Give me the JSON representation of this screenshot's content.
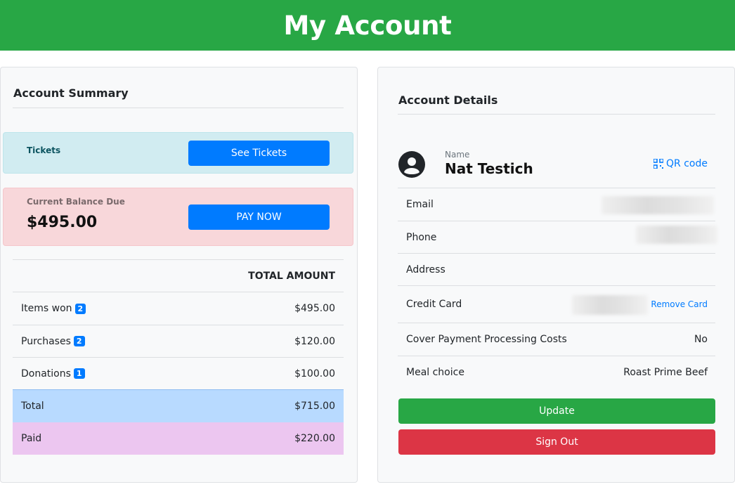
{
  "header": {
    "title": "My Account"
  },
  "summary": {
    "title": "Account Summary",
    "tickets": {
      "label": "Tickets",
      "button": "See Tickets"
    },
    "balance": {
      "label": "Current Balance Due",
      "amount": "$495.00",
      "button": "PAY NOW"
    },
    "table": {
      "header": "TOTAL AMOUNT",
      "rows": [
        {
          "label": "Items won",
          "badge": "2",
          "amount": "$495.00"
        },
        {
          "label": "Purchases",
          "badge": "2",
          "amount": "$120.00"
        },
        {
          "label": "Donations",
          "badge": "1",
          "amount": "$100.00"
        }
      ],
      "total": {
        "label": "Total",
        "amount": "$715.00"
      },
      "paid": {
        "label": "Paid",
        "amount": "$220.00"
      }
    }
  },
  "details": {
    "title": "Account Details",
    "name_label": "Name",
    "name": "Nat Testich",
    "qr_label": "QR code",
    "email_label": "Email",
    "phone_label": "Phone",
    "address_label": "Address",
    "card_label": "Credit Card",
    "remove_card": "Remove Card",
    "cover_label": "Cover Payment Processing Costs",
    "cover_value": "No",
    "meal_label": "Meal choice",
    "meal_value": "Roast Prime Beef",
    "update_button": "Update",
    "signout_button": "Sign Out"
  },
  "icons": {
    "avatar": "user-circle-icon",
    "qr": "qr-code-icon"
  },
  "colors": {
    "header_green": "#28a745",
    "primary_blue": "#007bff",
    "info_bg": "#d1ecf1",
    "danger_bg": "#f8d7da",
    "total_bg": "#b8daff",
    "paid_bg": "#ecc6f0",
    "signout_red": "#dc3545"
  }
}
